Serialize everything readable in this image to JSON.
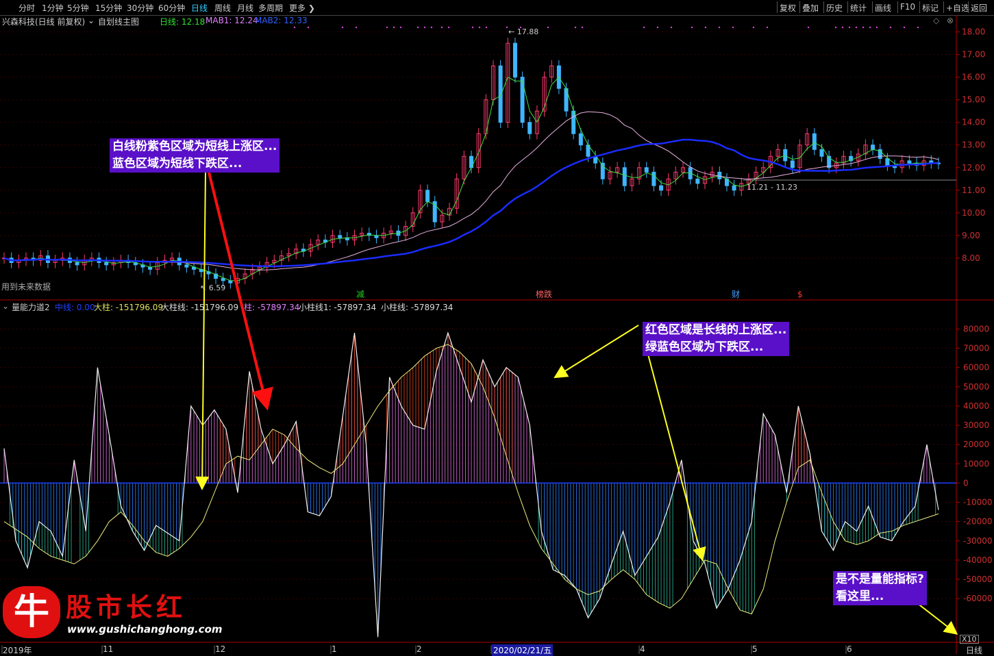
{
  "toolbar": {
    "left_items": [
      "分时",
      "1分钟",
      "5分钟",
      "15分钟",
      "30分钟",
      "60分钟",
      "日线",
      "周线",
      "月线",
      "多周期",
      "更多 ❯"
    ],
    "selected_index": 6,
    "right_items": [
      "复权",
      "叠加",
      "历史",
      "统计",
      "画线",
      "F10",
      "标记",
      "+自选",
      "返回"
    ]
  },
  "main_info": {
    "stock": "兴森科技(日线 前复权)",
    "template": "自划线主图",
    "daily_label": "日线: 12.18",
    "mab1_label": "MAB1: 12.24",
    "mab2_label": "MAB2: 12.33",
    "future_note": "用到未来数据"
  },
  "lower_info": {
    "indicator": "量能力道2",
    "mid_label": "中线: 0.00",
    "big_label": "大柱: -151796.09",
    "big_line_label": "大柱线: -151796.09",
    "small_label": "柱: -57897.34",
    "small_line1_label": "小柱线1: -57897.34",
    "small_line_label": "小柱线: -57897.34"
  },
  "callouts": {
    "c1_line1": "白线粉紫色区域为短线上涨区...",
    "c1_line2": "蓝色区域为短线下跌区...",
    "c2_line1": "红色区域是长线的上涨区...",
    "c2_line2": "绿蓝色区域为下跌区...",
    "c3_line1": "是不是量能指标?",
    "c3_line2": "看这里..."
  },
  "logo": {
    "char": "牛",
    "name": "股市长红",
    "url": "www.gushichanghong.com"
  },
  "markers": [
    "减",
    "榜跌",
    "财",
    "$"
  ],
  "bottom_axis": {
    "labels": [
      "2019年",
      "11",
      "12",
      "1",
      "2",
      "2020/02/21/五",
      "4",
      "5",
      "6"
    ],
    "period": "日线",
    "x10": "X10"
  },
  "colors": {
    "up": "#ff3b6e",
    "down": "#3fb6ff",
    "ma_white": "#e0e0e0",
    "ma_pink": "#e8b0e0",
    "ma_blue": "#1a2cff",
    "axis_red": "#b00000",
    "callout_bg": "#5a10c8"
  },
  "chart_data": [
    {
      "type": "candlestick",
      "title": "兴森科技(日线 前复权)",
      "ylim": [
        7.3,
        18.2
      ],
      "yticks": [
        "18.00",
        "17.00",
        "16.00",
        "15.00",
        "14.00",
        "13.00",
        "12.00",
        "11.00",
        "10.00",
        "9.00",
        "8.00"
      ],
      "annotations": {
        "high": "17.88",
        "low": "6.59",
        "range": "11.21 - 11.23"
      },
      "close": [
        8.0,
        7.8,
        7.9,
        8.0,
        7.9,
        8.1,
        7.8,
        7.9,
        8.0,
        7.8,
        7.7,
        7.9,
        8.0,
        7.8,
        7.7,
        7.8,
        7.9,
        7.8,
        7.7,
        7.6,
        7.5,
        7.8,
        7.9,
        8.0,
        7.7,
        7.6,
        7.5,
        7.4,
        7.3,
        7.1,
        7.0,
        6.9,
        7.1,
        7.3,
        7.5,
        7.6,
        7.8,
        7.9,
        8.1,
        8.2,
        8.4,
        8.3,
        8.6,
        8.8,
        8.7,
        9.0,
        8.9,
        8.8,
        9.0,
        9.1,
        9.0,
        8.9,
        9.1,
        9.2,
        9.0,
        9.4,
        10.0,
        11.0,
        10.5,
        9.6,
        9.9,
        10.2,
        11.5,
        12.5,
        12.0,
        13.5,
        15.0,
        16.5,
        14.0,
        17.5,
        16.0,
        14.0,
        13.5,
        14.5,
        16.0,
        16.5,
        15.5,
        14.5,
        13.5,
        13.0,
        12.5,
        12.2,
        11.5,
        11.8,
        12.0,
        11.2,
        11.5,
        12.0,
        11.8,
        11.2,
        11.0,
        11.5,
        11.8,
        12.0,
        11.5,
        11.3,
        11.6,
        11.8,
        11.5,
        11.2,
        11.0,
        11.3,
        11.5,
        11.8,
        12.0,
        12.5,
        12.8,
        12.3,
        12.0,
        13.0,
        13.5,
        12.8,
        12.5,
        12.0,
        12.2,
        12.5,
        12.3,
        12.6,
        13.0,
        12.8,
        12.4,
        12.1,
        12.0,
        12.3,
        12.2,
        12.1,
        12.3,
        12.2,
        12.18
      ]
    },
    {
      "type": "bar",
      "title": "量能力道2",
      "ylim": [
        -82000,
        88000
      ],
      "yticks": [
        "80000",
        "70000",
        "60000",
        "50000",
        "40000",
        "30000",
        "20000",
        "10000",
        "0",
        "-10000",
        "-20000",
        "-30000",
        "-40000",
        "-50000",
        "-60000"
      ],
      "white_line": [
        18000,
        -30000,
        -44000,
        -20000,
        -25000,
        -38000,
        12000,
        -25000,
        60000,
        25000,
        -12000,
        -25000,
        -35000,
        -22000,
        -26000,
        -30000,
        40000,
        30000,
        38000,
        28000,
        -5000,
        58000,
        28000,
        10000,
        20000,
        32000,
        -15000,
        -17000,
        -7000,
        35000,
        78000,
        20000,
        -80000,
        55000,
        40000,
        30000,
        28000,
        58000,
        78000,
        60000,
        42000,
        64000,
        50000,
        60000,
        55000,
        30000,
        -25000,
        -45000,
        -48000,
        -55000,
        -70000,
        -60000,
        -42000,
        -25000,
        -48000,
        -38000,
        -28000,
        -10000,
        12000,
        -30000,
        -42000,
        -65000,
        -55000,
        -40000,
        -20000,
        36000,
        25000,
        -5000,
        40000,
        15000,
        -25000,
        -35000,
        -20000,
        -25000,
        -12000,
        -28000,
        -30000,
        -20000,
        -12000,
        20000,
        -14000
      ],
      "long_line": [
        -20000,
        -24000,
        -28000,
        -34000,
        -38000,
        -40000,
        -42000,
        -38000,
        -30000,
        -20000,
        -15000,
        -22000,
        -30000,
        -36000,
        -38000,
        -34000,
        -28000,
        -20000,
        -5000,
        10000,
        14000,
        12000,
        20000,
        28000,
        25000,
        18000,
        12000,
        8000,
        5000,
        10000,
        20000,
        30000,
        40000,
        48000,
        55000,
        60000,
        66000,
        70000,
        72000,
        68000,
        62000,
        50000,
        34000,
        14000,
        -5000,
        -22000,
        -34000,
        -42000,
        -50000,
        -55000,
        -58000,
        -56000,
        -50000,
        -45000,
        -50000,
        -58000,
        -62000,
        -65000,
        -60000,
        -50000,
        -40000,
        -42000,
        -55000,
        -66000,
        -68000,
        -55000,
        -30000,
        -10000,
        8000,
        12000,
        -5000,
        -20000,
        -30000,
        -32000,
        -30000,
        -26000,
        -25000,
        -22000,
        -20000,
        -18000,
        -16000
      ]
    }
  ]
}
